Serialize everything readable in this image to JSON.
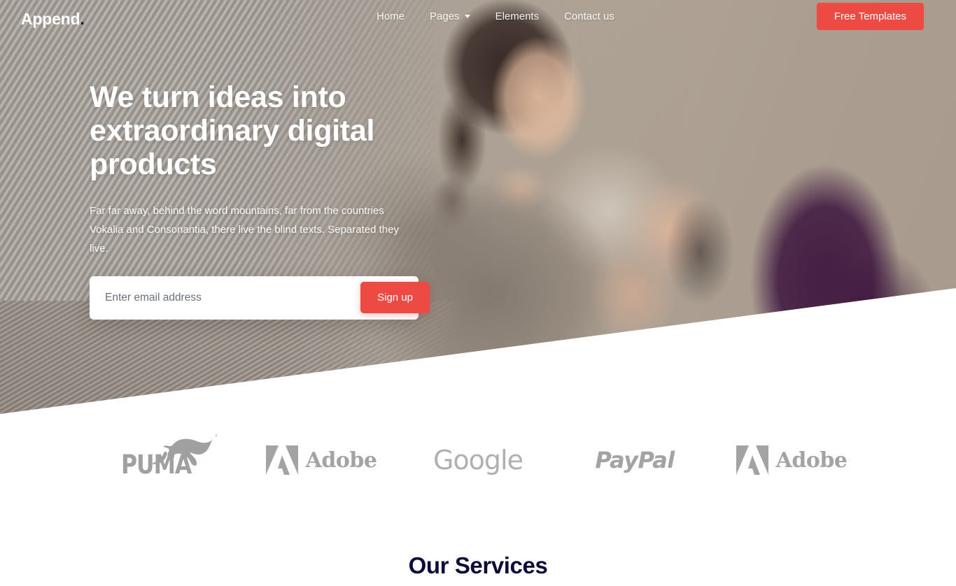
{
  "brand": {
    "name": "Append",
    "dot": "."
  },
  "nav": {
    "links": [
      {
        "label": "Home",
        "has_caret": false
      },
      {
        "label": "Pages",
        "has_caret": true
      },
      {
        "label": "Elements",
        "has_caret": false
      },
      {
        "label": "Contact us",
        "has_caret": false
      }
    ],
    "cta_label": "Free Templates"
  },
  "hero": {
    "headline": "We turn ideas into extraordinary digital products",
    "subtext": "Far far away, behind the word mountains, far from the countries Vokalia and Consonantia, there live the blind texts. Separated they live.",
    "email_placeholder": "Enter email address",
    "email_value": "",
    "signup_label": "Sign up"
  },
  "logos": [
    {
      "name": "PUMA",
      "text": "PUMA"
    },
    {
      "name": "Adobe",
      "text": "Adobe"
    },
    {
      "name": "Google",
      "text": "Google"
    },
    {
      "name": "PayPal",
      "text": "PayPal"
    },
    {
      "name": "Adobe",
      "text": "Adobe"
    }
  ],
  "services": {
    "title": "Our Services"
  },
  "colors": {
    "accent": "#ee4a44",
    "heading_dark": "#0c0c3c",
    "logo_gray": "#a3a3a3",
    "hero_wall": "#ab9e90",
    "white": "#ffffff"
  }
}
